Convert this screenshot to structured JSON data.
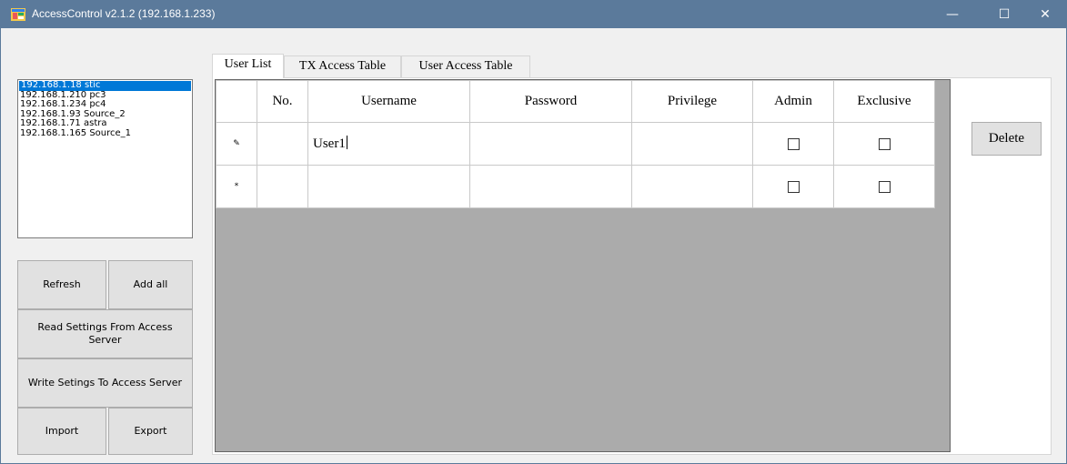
{
  "window": {
    "title": "AccessControl v2.1.2 (192.168.1.233)",
    "controls": {
      "minimize": "—",
      "maximize": "☐",
      "close": "✕"
    }
  },
  "hosts": [
    {
      "label": "192.168.1.18 stic",
      "selected": true
    },
    {
      "label": "192.168.1.210 pc3",
      "selected": false
    },
    {
      "label": "192.168.1.234 pc4",
      "selected": false
    },
    {
      "label": "192.168.1.93 Source_2",
      "selected": false
    },
    {
      "label": "192.168.1.71 astra",
      "selected": false
    },
    {
      "label": "192.168.1.165 Source_1",
      "selected": false
    }
  ],
  "buttons": {
    "refresh": "Refresh",
    "add_all": "Add all",
    "read_settings": "Read Settings From Access Server",
    "write_settings": "Write Setings To Access Server",
    "import": "Import",
    "export": "Export",
    "delete": "Delete"
  },
  "tabs": [
    {
      "label": "User List",
      "active": true
    },
    {
      "label": "TX Access Table",
      "active": false
    },
    {
      "label": "User Access Table",
      "active": false
    }
  ],
  "grid": {
    "columns": [
      "No.",
      "Username",
      "Password",
      "Privilege",
      "Admin",
      "Exclusive"
    ],
    "rows": [
      {
        "indicator": "✎",
        "no": "",
        "username": "User1",
        "password": "",
        "privilege": "",
        "admin": false,
        "exclusive": false,
        "editing": true
      },
      {
        "indicator": "*",
        "no": "",
        "username": "",
        "password": "",
        "privilege": "",
        "admin": false,
        "exclusive": false,
        "editing": false
      }
    ]
  },
  "colors": {
    "titlebar": "#5b7a9b",
    "selection": "#0078d7",
    "grid_background": "#ababab"
  },
  "icons": {
    "app": "app-icon",
    "edit_row": "pencil-icon",
    "new_row": "asterisk-icon"
  }
}
